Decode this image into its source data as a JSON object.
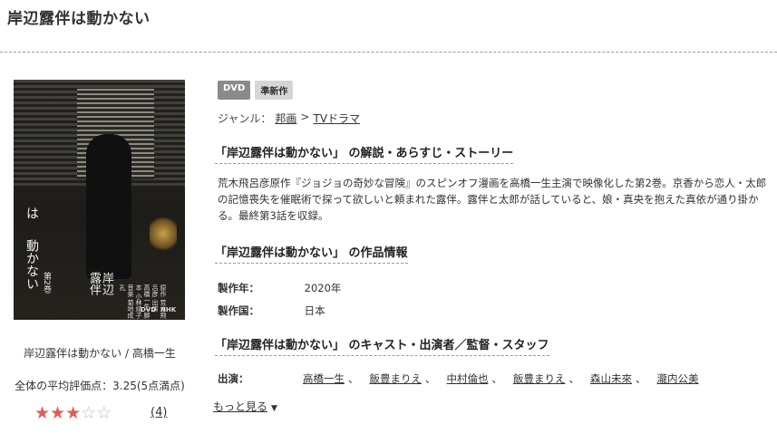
{
  "page": {
    "title": "岸辺露伴は動かない"
  },
  "cover": {
    "title_lines": [
      "岸辺",
      "露伴",
      "は",
      "動かない"
    ],
    "credits": "原作 荒木飛呂彦 出演 高橋一生 脚本 小林靖子 音楽 菊地成孔",
    "volume": "第2巻",
    "dvd_logo": "DVD",
    "nhk_logo": "NHK"
  },
  "left": {
    "caption": "岸辺露伴は動かない / 高橋一生",
    "rating_text": "全体の平均評価点：3.25(5点満点)",
    "rating_value": 3.25,
    "rating_max": 5,
    "stars": [
      "on",
      "on",
      "on",
      "off",
      "off"
    ],
    "star_glyph_on": "★",
    "star_glyph_off": "☆",
    "rating_count": "(4)"
  },
  "badges": {
    "dvd": "DVD",
    "new": "準新作"
  },
  "genre": {
    "label": "ジャンル：",
    "items": [
      "邦画",
      "TVドラマ"
    ],
    "separator": ">"
  },
  "sections": {
    "synopsis_title": "「岸辺露伴は動かない」 の解説・あらすじ・ストーリー",
    "info_title": "「岸辺露伴は動かない」 の作品情報",
    "cast_title": "「岸辺露伴は動かない」 のキャスト・出演者／監督・スタッフ"
  },
  "synopsis": "荒木飛呂彦原作『ジョジョの奇妙な冒険』のスピンオフ漫画を高橋一生主演で映像化した第2巻。京香から恋人・太郎の記憶喪失を催眠術で探って欲しいと頼まれた露伴。露伴と太郎が話していると、娘・真央を抱えた真依が通り掛かる。最終第3話を収録。",
  "info": {
    "year_label": "製作年：",
    "year_value": "2020年",
    "country_label": "製作国：",
    "country_value": "日本"
  },
  "cast": {
    "label": "出演：",
    "names": [
      "高橋一生",
      "飯豊まりえ",
      "中村倫也",
      "飯豊まりえ",
      "森山未來",
      "瀧内公美"
    ],
    "separator": "、"
  },
  "more": {
    "label": "もっと見る",
    "icon": "chevron-down-icon"
  }
}
